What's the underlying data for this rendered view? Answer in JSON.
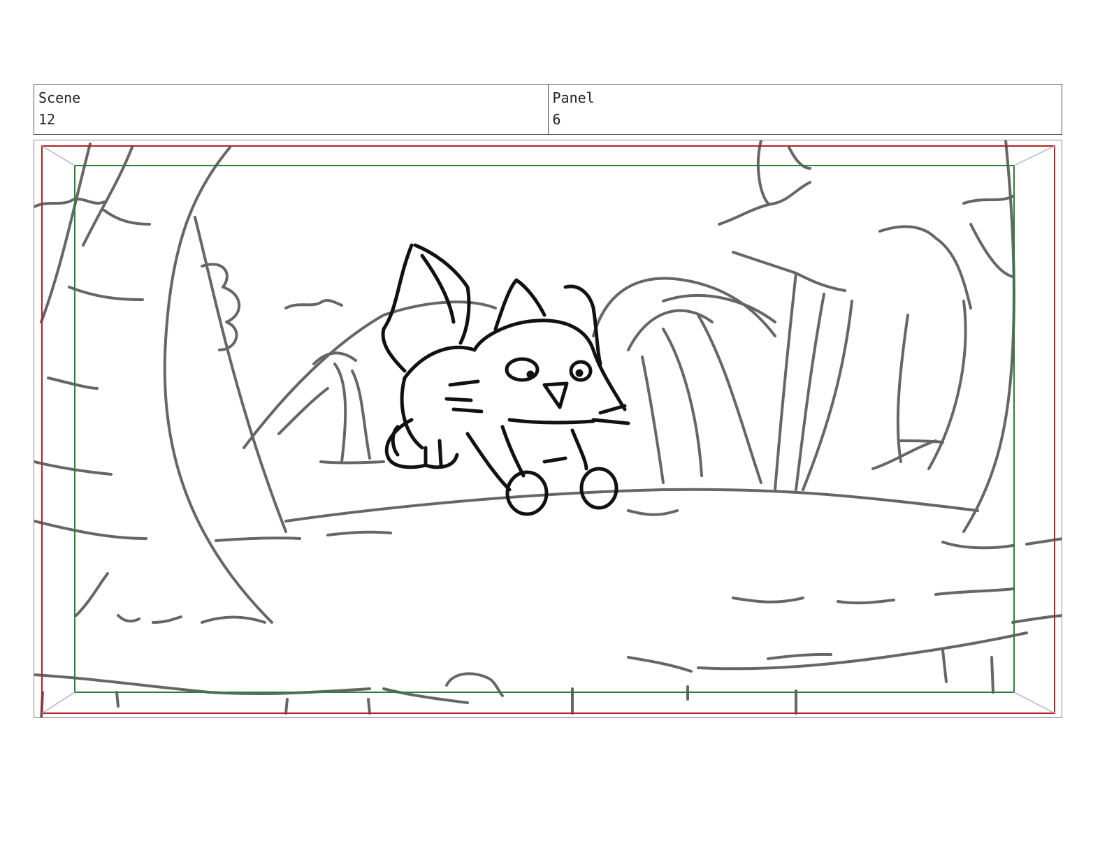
{
  "header": {
    "scene_label": "Scene",
    "scene_value": "12",
    "panel_label": "Panel",
    "panel_value": "6"
  },
  "colors": {
    "action_safe": "#b22222",
    "title_safe": "#2e7d32",
    "background_lines": "#666666",
    "character_lines": "#111111"
  }
}
